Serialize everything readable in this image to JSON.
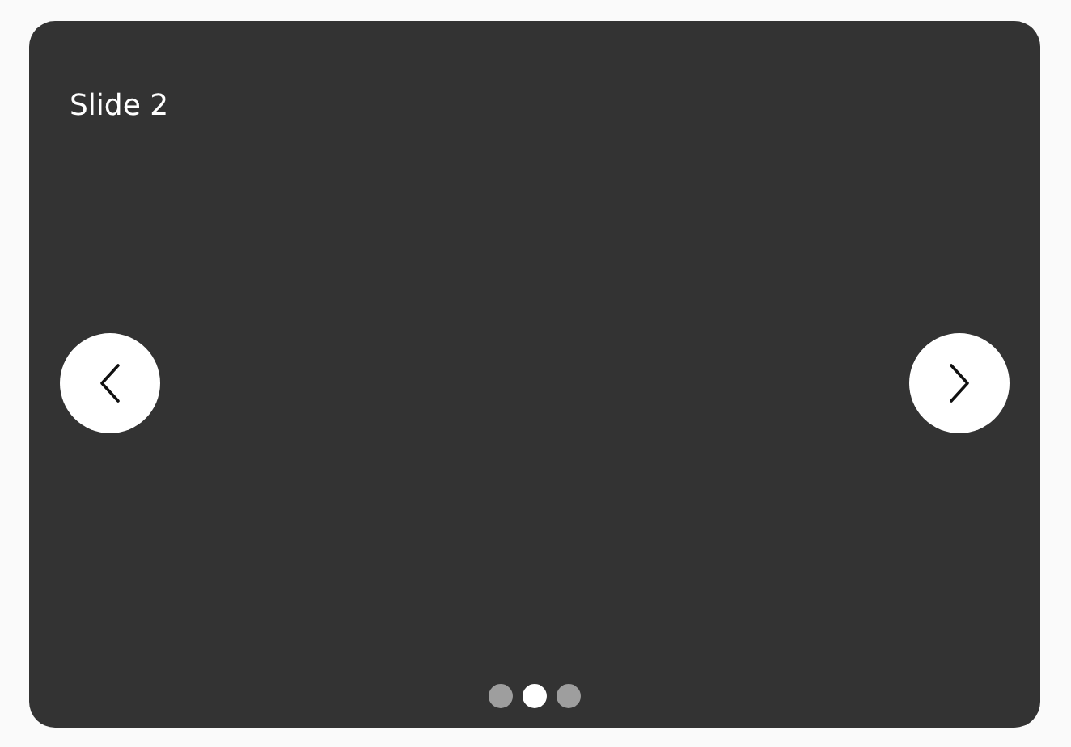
{
  "slide": {
    "title": "Slide 2"
  },
  "dots": [
    {
      "selected": false
    },
    {
      "selected": true
    },
    {
      "selected": false
    }
  ]
}
